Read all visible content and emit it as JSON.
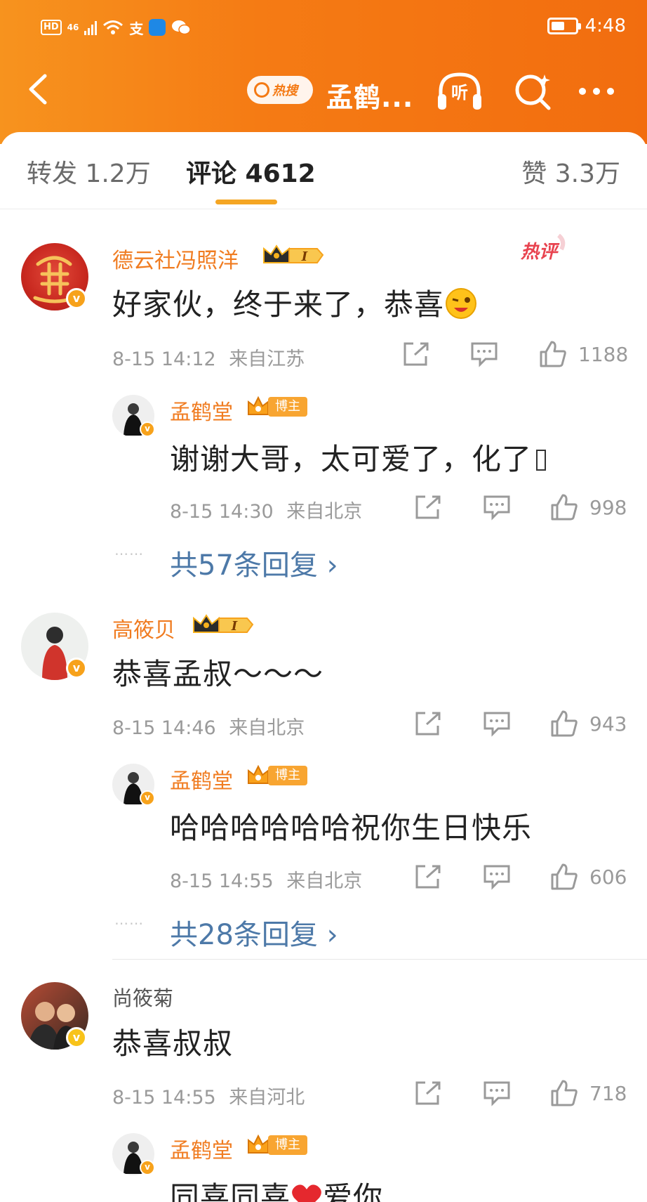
{
  "status_bar": {
    "signal": "46",
    "time": "4:48",
    "hd": "HD",
    "carrier_icon": "支"
  },
  "nav": {
    "hot_search": "热搜",
    "title": "孟鹤...",
    "listen": "听"
  },
  "tabs": {
    "repost": "转发 1.2万",
    "comments": "评论 4612",
    "likes": "赞 3.3万"
  },
  "colors": {
    "accent": "#f57b14",
    "name": "#f07c21",
    "link": "#4d79a8"
  },
  "hot_label": "热评",
  "comments": [
    {
      "user": "德云社冯照洋",
      "text": "好家伙，终于来了，恭喜",
      "emoji": "wink-emoji",
      "time": "8-15 14:12",
      "location": "来自江苏",
      "likes": "1188",
      "reply": {
        "user": "孟鹤堂",
        "tag": "博主",
        "text": "谢谢大哥，太可爱了，化了",
        "time": "8-15 14:30",
        "location": "来自北京",
        "likes": "998"
      },
      "more": "共57条回复 ›"
    },
    {
      "user": "高筱贝",
      "text": "恭喜孟叔～～～",
      "time": "8-15 14:46",
      "location": "来自北京",
      "likes": "943",
      "reply": {
        "user": "孟鹤堂",
        "tag": "博主",
        "text": "哈哈哈哈哈哈祝你生日快乐",
        "time": "8-15 14:55",
        "location": "来自北京",
        "likes": "606"
      },
      "more": "共28条回复 ›"
    },
    {
      "user": "尚筱菊",
      "text": "恭喜叔叔",
      "time": "8-15 14:55",
      "location": "来自河北",
      "likes": "718",
      "reply": {
        "user": "孟鹤堂",
        "tag": "博主",
        "text_a": "同喜同喜",
        "text_b": "爱你"
      }
    }
  ],
  "crown_level": "I",
  "v": "v"
}
